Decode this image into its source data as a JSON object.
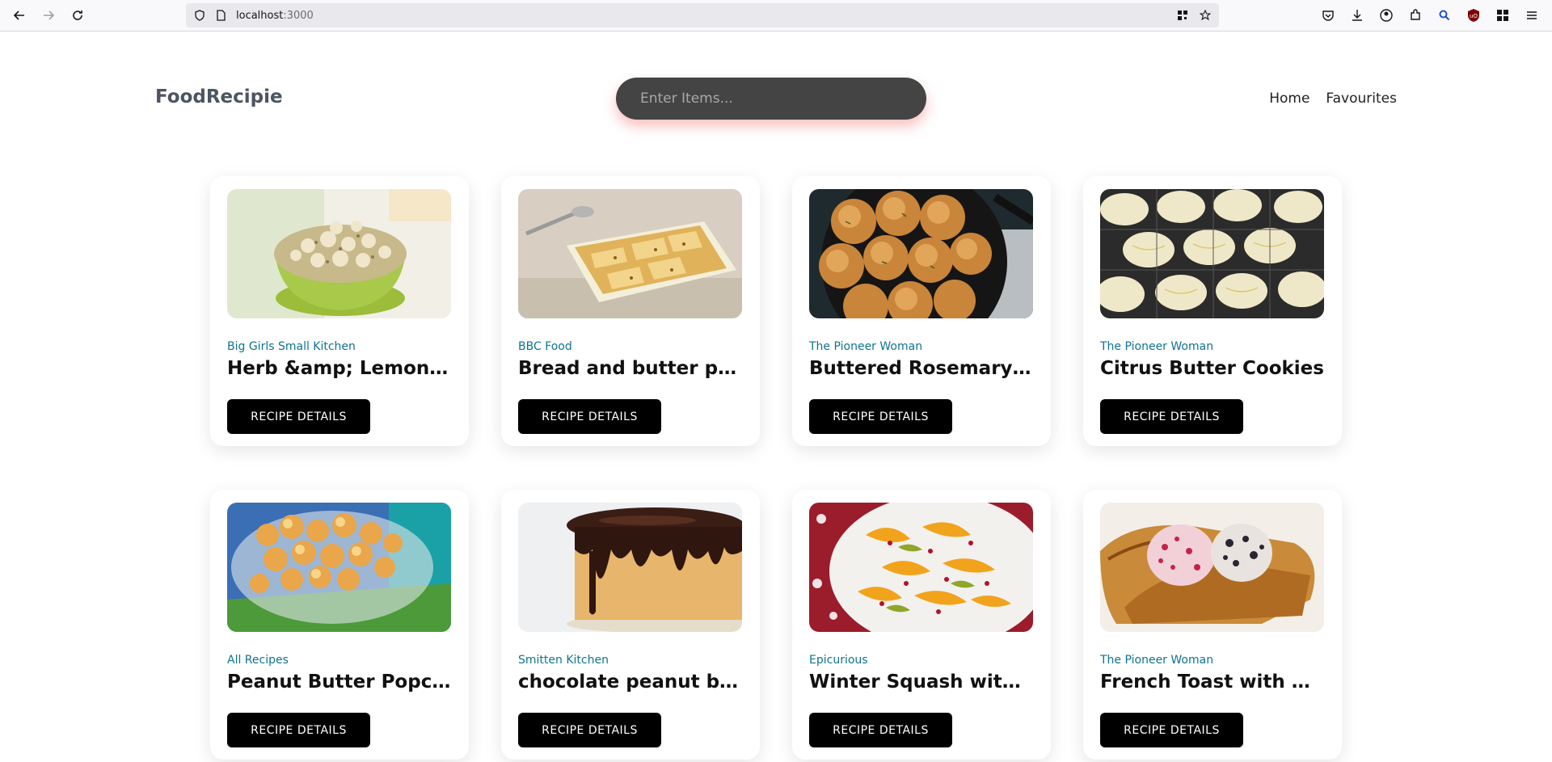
{
  "browser": {
    "url_host": "localhost",
    "url_port": ":3000"
  },
  "header": {
    "logo": "FoodRecipie",
    "search_placeholder": "Enter Items...",
    "nav": [
      "Home",
      "Favourites"
    ]
  },
  "recipes": [
    {
      "publisher": "Big Girls Small Kitchen",
      "title": "Herb &amp; Lemon Bu...",
      "button": "RECIPE DETAILS",
      "image": "popcorn-bowl-green"
    },
    {
      "publisher": "BBC Food",
      "title": "Bread and butter pud...",
      "button": "RECIPE DETAILS",
      "image": "bread-pudding-dish"
    },
    {
      "publisher": "The Pioneer Woman",
      "title": "Buttered Rosemary R...",
      "button": "RECIPE DETAILS",
      "image": "rosemary-rolls-skillet"
    },
    {
      "publisher": "The Pioneer Woman",
      "title": "Citrus Butter Cookies",
      "button": "RECIPE DETAILS",
      "image": "glazed-cookies-rack"
    },
    {
      "publisher": "All Recipes",
      "title": "Peanut Butter Popcorn",
      "button": "RECIPE DETAILS",
      "image": "popcorn-glass-bowl"
    },
    {
      "publisher": "Smitten Kitchen",
      "title": "chocolate peanut butt...",
      "button": "RECIPE DETAILS",
      "image": "chocolate-drip-cake"
    },
    {
      "publisher": "Epicurious",
      "title": "Winter Squash with S...",
      "button": "RECIPE DETAILS",
      "image": "squash-pomegranate"
    },
    {
      "publisher": "The Pioneer Woman",
      "title": "French Toast with Ber...",
      "button": "RECIPE DETAILS",
      "image": "french-toast-berry-butter"
    }
  ],
  "colors": {
    "publisher": "#0e7490",
    "button_bg": "#000000",
    "search_bg": "#444444"
  }
}
